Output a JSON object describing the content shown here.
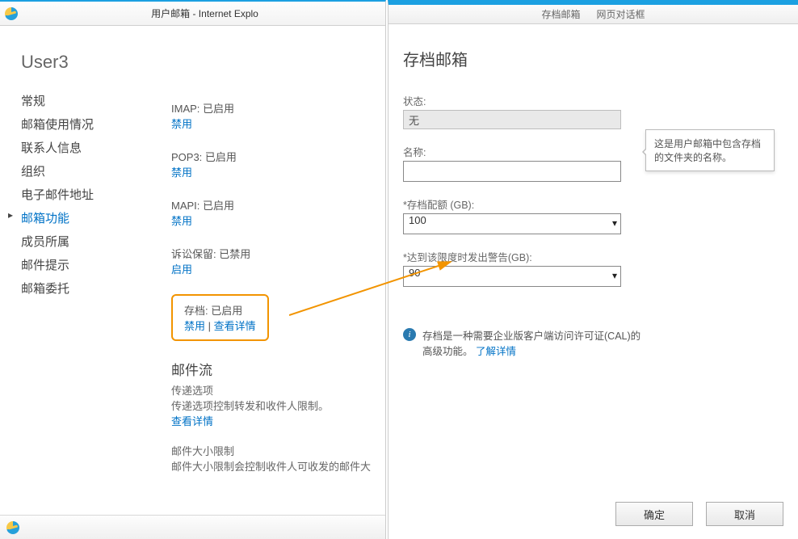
{
  "left": {
    "window_title": "用户邮箱 - Internet Explo",
    "user_heading": "User3",
    "sidebar": [
      "常规",
      "邮箱使用情况",
      "联系人信息",
      "组织",
      "电子邮件地址",
      "邮箱功能",
      "成员所属",
      "邮件提示",
      "邮箱委托"
    ],
    "sidebar_selected_index": 5,
    "features": {
      "imap": {
        "label": "IMAP: 已启用",
        "action": "禁用"
      },
      "pop3": {
        "label": "POP3: 已启用",
        "action": "禁用"
      },
      "mapi": {
        "label": "MAPI: 已启用",
        "action": "禁用"
      },
      "litigation": {
        "label": "诉讼保留: 已禁用",
        "action": "启用"
      },
      "archive": {
        "label": "存档: 已启用",
        "disable_action": "禁用",
        "separator": " | ",
        "detail_action": "查看详情"
      }
    },
    "mailflow": {
      "title": "邮件流",
      "delivery_subtitle": "传递选项",
      "delivery_desc": "传递选项控制转发和收件人限制。",
      "delivery_link": "查看详情",
      "size_subtitle": "邮件大小限制",
      "size_desc": "邮件大小限制会控制收件人可收发的邮件大"
    }
  },
  "right": {
    "titlebar_left": "存档邮箱",
    "titlebar_right": "网页对话框",
    "dialog_title": "存档邮箱",
    "status_label": "状态:",
    "status_value": "无",
    "name_label": "名称:",
    "name_value": "",
    "tooltip": "这是用户邮箱中包含存档的文件夹的名称。",
    "quota_label": "*存档配额 (GB):",
    "quota_value": "100",
    "warn_label": "*达到该限度时发出警告(GB):",
    "warn_value": "90",
    "info_text": "存档是一种需要企业版客户端访问许可证(CAL)的高级功能。",
    "info_link": "了解详情",
    "ok_button": "确定",
    "cancel_button": "取消"
  }
}
